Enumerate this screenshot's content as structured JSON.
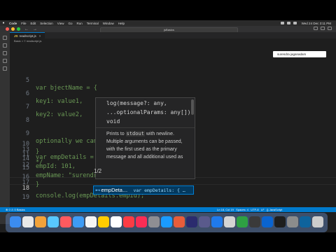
{
  "menubar": {
    "items": [
      "Code",
      "File",
      "Edit",
      "Selection",
      "View",
      "Go",
      "Run",
      "Terminal",
      "Window",
      "Help"
    ],
    "clock": "Wed 24 Dec  3:11 PM"
  },
  "window": {
    "command_center": "jsBasics",
    "tab": {
      "name": "readscript.js",
      "close": "×"
    },
    "breadcrumb": "Basic > ≡ readscript.js"
  },
  "user_chip": "surendra jaganadam",
  "editor": {
    "lines": [
      {
        "num": "5",
        "text": "var bjectName = {"
      },
      {
        "num": "6",
        "text": "key1: value1,"
      },
      {
        "num": "7",
        "text": "key2: value2,"
      },
      {
        "num": "8",
        "text": ""
      },
      {
        "num": "9",
        "text": "optionally we can add function also"
      },
      {
        "num": "10",
        "text": "}"
      },
      {
        "num": "11",
        "text": "*/"
      },
      {
        "num": "12",
        "text": ""
      },
      {
        "num": "13",
        "text": "var empDetails = {"
      },
      {
        "num": "14",
        "text": "empId: 101,"
      },
      {
        "num": "15",
        "text": "empName: \"surendr"
      },
      {
        "num": "16",
        "text": "}"
      },
      {
        "num": "17",
        "text": ""
      },
      {
        "num": "18",
        "text": "console.log(empDetails.empId);"
      },
      {
        "num": "19",
        "text": ""
      }
    ],
    "active_line": "18"
  },
  "tooltip": {
    "sig_line1": "log(message?: any,",
    "sig_line2": "...optionalParams: any[]):",
    "sig_line3": "void",
    "doc_line1_a": "Prints to ",
    "doc_line1_code": "stdout",
    "doc_line1_b": " with newline.",
    "doc_line2": "Multiple arguments can be passed,",
    "doc_line3": "with the first used as the primary",
    "doc_line4": "message and all additional used as"
  },
  "param_counter": "1/2",
  "suggestion": {
    "label": "empDeta…",
    "detail": "var empDetails: { …"
  },
  "status": {
    "left": "⊗ 0 ⚠ 0    Basics",
    "right": "Ln 18, Col 19   Spaces: 4   UTF-8   LF   {} JavaScript"
  },
  "dock_colors": [
    "#3b8cf0",
    "#e8e8e8",
    "#f2a23a",
    "#58c8ff",
    "#ff5a5f",
    "#3d9bf5",
    "#f5f5f5",
    "#ffcc00",
    "#ffffff",
    "#fc3c44",
    "#fa2d55",
    "#8e8e93",
    "#1a9bff",
    "#e85d3a",
    "#2b2b6e",
    "#5a5a8c",
    "#1f7aeb",
    "#d4d4d4",
    "#2ea043",
    "#3a3a3a",
    "#0a64d0",
    "#1e1e1e",
    "#8c8c8c",
    "#0e639c",
    "#cccccc"
  ]
}
